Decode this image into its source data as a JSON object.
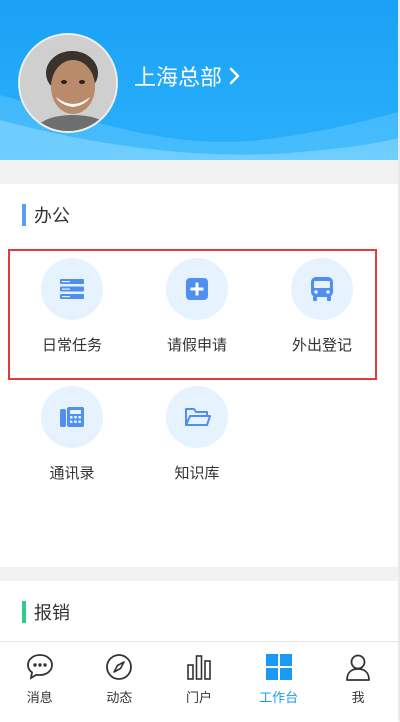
{
  "header": {
    "org_name": "上海总部",
    "avatar_icon": "user-avatar-photo",
    "bg_color": "#1aa1f5"
  },
  "office": {
    "title": "办公",
    "accent": "#5b9cf5",
    "items": [
      {
        "label": "日常任务",
        "icon": "list-icon"
      },
      {
        "label": "请假申请",
        "icon": "plus-square-icon"
      },
      {
        "label": "外出登记",
        "icon": "bus-icon"
      },
      {
        "label": "通讯录",
        "icon": "phone-book-icon"
      },
      {
        "label": "知识库",
        "icon": "folder-icon"
      }
    ]
  },
  "expense": {
    "title": "报销",
    "accent": "#2ecc8f"
  },
  "tabbar": {
    "items": [
      {
        "label": "消息",
        "icon": "chat-icon"
      },
      {
        "label": "动态",
        "icon": "compass-icon"
      },
      {
        "label": "门户",
        "icon": "bar-chart-icon"
      },
      {
        "label": "工作台",
        "icon": "grid-icon",
        "active": true
      },
      {
        "label": "我",
        "icon": "person-icon"
      }
    ],
    "active_color": "#1a9af5"
  }
}
